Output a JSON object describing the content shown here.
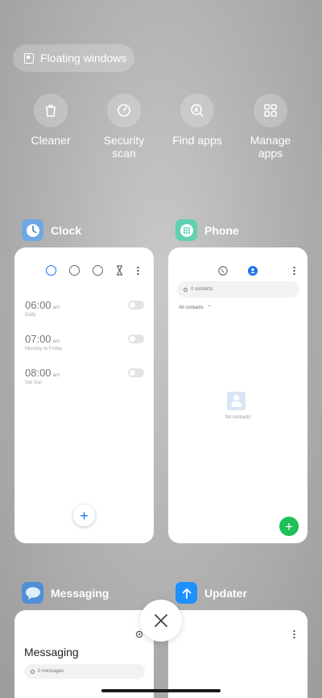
{
  "floating_windows": {
    "label": "Floating windows"
  },
  "tools": [
    {
      "label": "Cleaner",
      "icon": "trash-icon"
    },
    {
      "label": "Security\nscan",
      "icon": "shield-scan-icon"
    },
    {
      "label": "Find apps",
      "icon": "find-apps-icon"
    },
    {
      "label": "Manage\napps",
      "icon": "grid-icon"
    }
  ],
  "apps": {
    "clock": {
      "name": "Clock",
      "alarms": [
        {
          "time": "06:00",
          "ampm": "am",
          "desc": "Daily"
        },
        {
          "time": "07:00",
          "ampm": "am",
          "desc": "Monday to Friday"
        },
        {
          "time": "08:00",
          "ampm": "am",
          "desc": "Sat Sun"
        }
      ],
      "fab": "+"
    },
    "phone": {
      "name": "Phone",
      "search_placeholder": "0 contacts",
      "filter": "All contacts",
      "empty": "No contacts",
      "fab": "+"
    },
    "messaging": {
      "name": "Messaging",
      "title": "Messaging",
      "search_placeholder": "0 messages"
    },
    "updater": {
      "name": "Updater"
    }
  },
  "colors": {
    "accent_blue": "#1a73e8",
    "phone_green": "#1fbf5a",
    "clock_icon": "#6fa7e6",
    "phone_icon": "#5fd0b0",
    "messaging_icon": "#4f8fd8",
    "updater_icon": "#1e90ff"
  }
}
